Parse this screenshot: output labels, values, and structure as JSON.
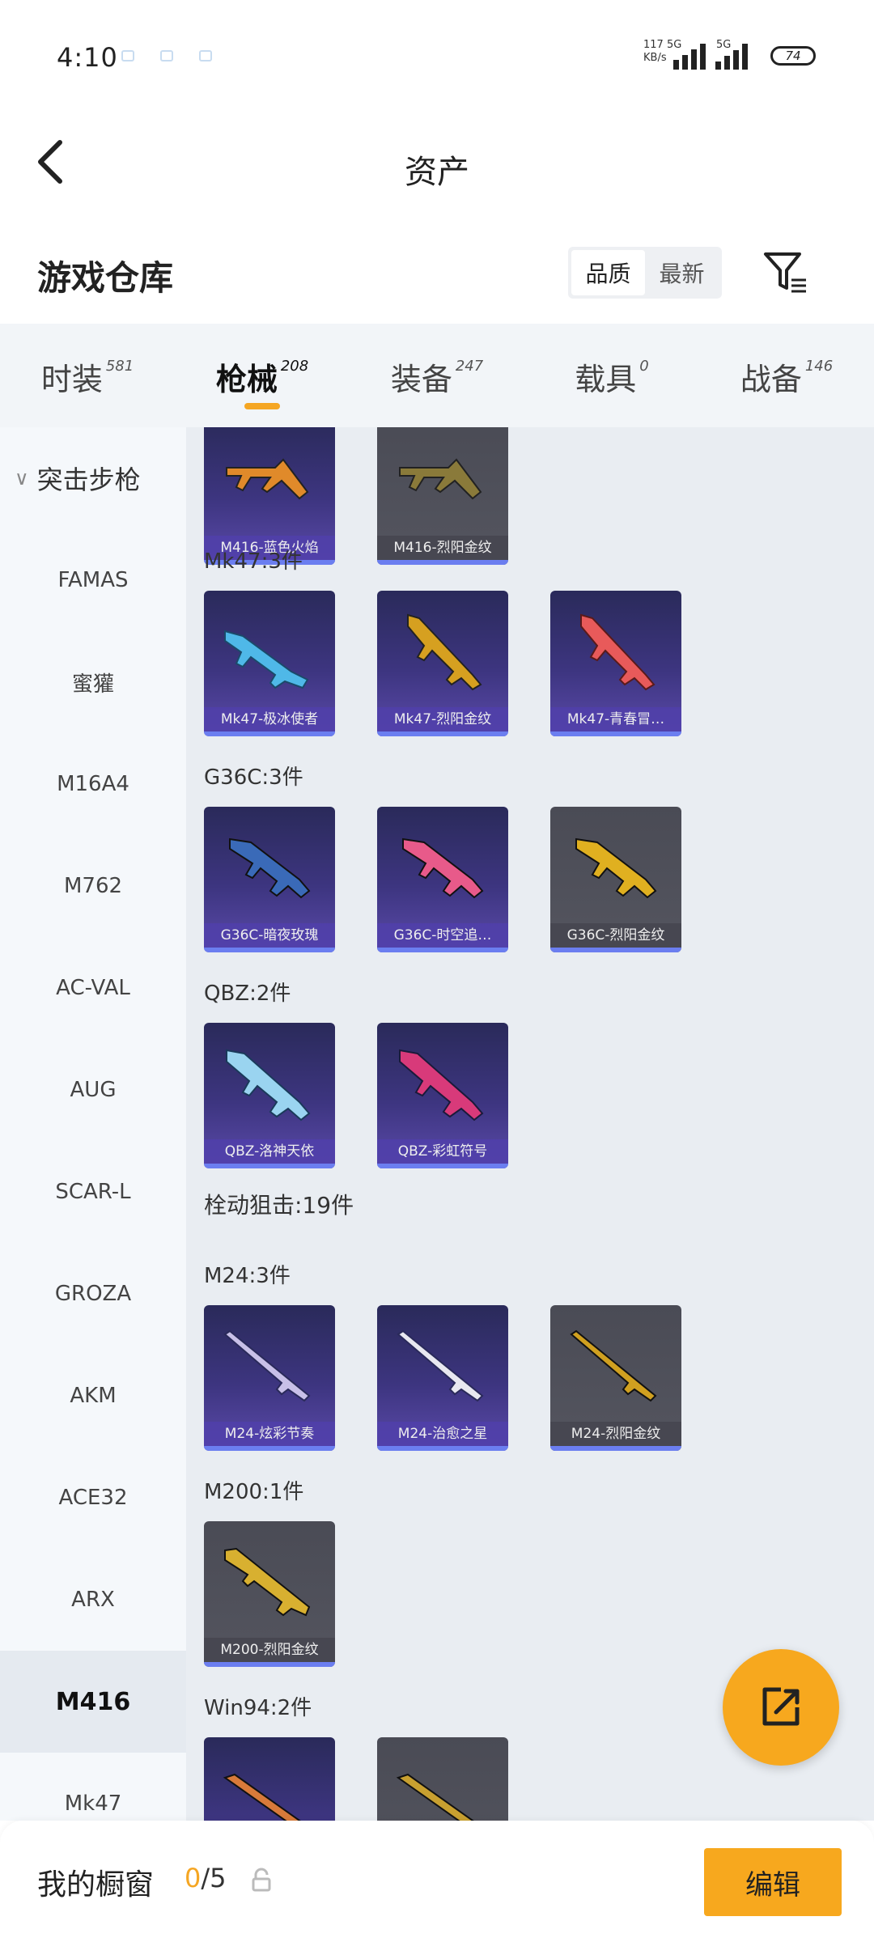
{
  "status_bar": {
    "time": "4:10",
    "net_speed": "117",
    "net_unit": "KB/s",
    "net_type_1": "5G",
    "net_type_2": "5G",
    "battery": "74"
  },
  "header": {
    "title": "资产",
    "back_icon": "chevron-left-icon"
  },
  "section": {
    "title": "游戏仓库",
    "sort_options": [
      "品质",
      "最新"
    ],
    "active_sort": "品质",
    "filter_icon": "filter-icon"
  },
  "tabs": [
    {
      "label": "时装",
      "count": "581"
    },
    {
      "label": "枪械",
      "count": "208"
    },
    {
      "label": "装备",
      "count": "247"
    },
    {
      "label": "载具",
      "count": "0"
    },
    {
      "label": "战备",
      "count": "146"
    }
  ],
  "active_tab": "枪械",
  "sidebar": {
    "group": "突击步枪",
    "items": [
      "FAMAS",
      "蜜獾",
      "M16A4",
      "M762",
      "AC-VAL",
      "AUG",
      "SCAR-L",
      "GROZA",
      "AKM",
      "ACE32",
      "ARX",
      "M416",
      "Mk47"
    ],
    "active_item": "M416"
  },
  "content": {
    "top_cards": [
      {
        "name": "M416-蓝色火焰",
        "quality": "purple"
      },
      {
        "name": "M416-烈阳金纹",
        "quality": "gold"
      }
    ],
    "groups": [
      {
        "label": "Mk47:3件",
        "cards": [
          {
            "name": "Mk47-极冰使者",
            "quality": "purple"
          },
          {
            "name": "Mk47-烈阳金纹",
            "quality": "purple"
          },
          {
            "name": "Mk47-青春冒…",
            "quality": "purple"
          }
        ]
      },
      {
        "label": "G36C:3件",
        "cards": [
          {
            "name": "G36C-暗夜玫瑰",
            "quality": "purple"
          },
          {
            "name": "G36C-时空追…",
            "quality": "purple"
          },
          {
            "name": "G36C-烈阳金纹",
            "quality": "gold"
          }
        ]
      },
      {
        "label": "QBZ:2件",
        "cards": [
          {
            "name": "QBZ-洛神天依",
            "quality": "purple"
          },
          {
            "name": "QBZ-彩虹符号",
            "quality": "purple"
          }
        ]
      },
      {
        "label": "栓动狙击:19件",
        "cards": []
      },
      {
        "label": "M24:3件",
        "cards": [
          {
            "name": "M24-炫彩节奏",
            "quality": "purple"
          },
          {
            "name": "M24-治愈之星",
            "quality": "purple"
          },
          {
            "name": "M24-烈阳金纹",
            "quality": "gold"
          }
        ]
      },
      {
        "label": "M200:1件",
        "cards": [
          {
            "name": "M200-烈阳金纹",
            "quality": "gold"
          }
        ]
      },
      {
        "label": "Win94:2件",
        "cards": [
          {
            "name": "",
            "quality": "purple"
          },
          {
            "name": "",
            "quality": "gold"
          }
        ]
      }
    ]
  },
  "fab": {
    "icon": "share-export-icon"
  },
  "bottom_bar": {
    "label": "我的橱窗",
    "current": "0",
    "total": "/5",
    "lock_icon": "lock-icon",
    "edit_label": "编辑"
  },
  "colors": {
    "accent": "#f7a81e",
    "purple_card": "#3d3580",
    "gold_card": "#54555f",
    "stripe": "#6b7ef0"
  }
}
